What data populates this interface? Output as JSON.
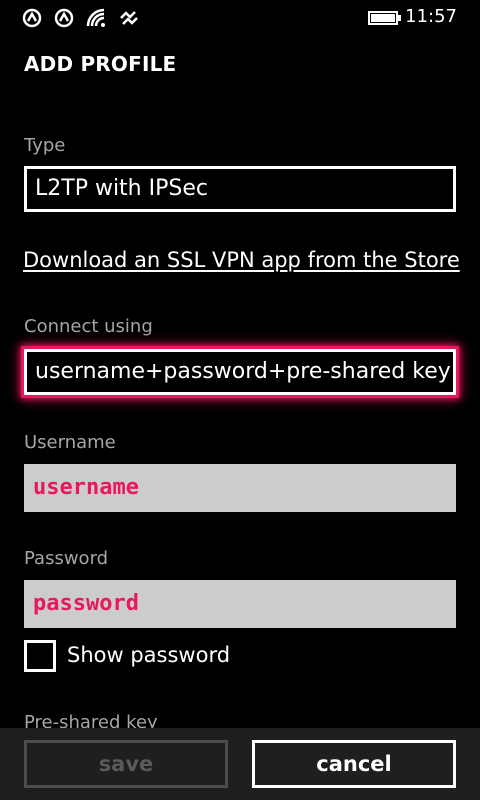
{
  "status_bar": {
    "time": "11:57",
    "icons": [
      "signal-icon-1",
      "signal-icon-2",
      "wifi-icon",
      "data-icon",
      "battery-icon"
    ]
  },
  "page": {
    "title": "ADD PROFILE"
  },
  "form": {
    "type_label": "Type",
    "type_value": "L2TP with IPSec",
    "store_link": "Download an SSL VPN app from the Store",
    "connect_label": "Connect using",
    "connect_value": "username+password+pre-shared key",
    "username_label": "Username",
    "username_value": "username",
    "password_label": "Password",
    "password_value": "password",
    "show_password_label": "Show password",
    "show_password_checked": false,
    "psk_label": "Pre-shared key"
  },
  "appbar": {
    "save_label": "save",
    "cancel_label": "cancel"
  },
  "colors": {
    "accent": "#e8185a",
    "background": "#000000",
    "label": "#a6a6a6",
    "input_bg": "#cccccc"
  }
}
